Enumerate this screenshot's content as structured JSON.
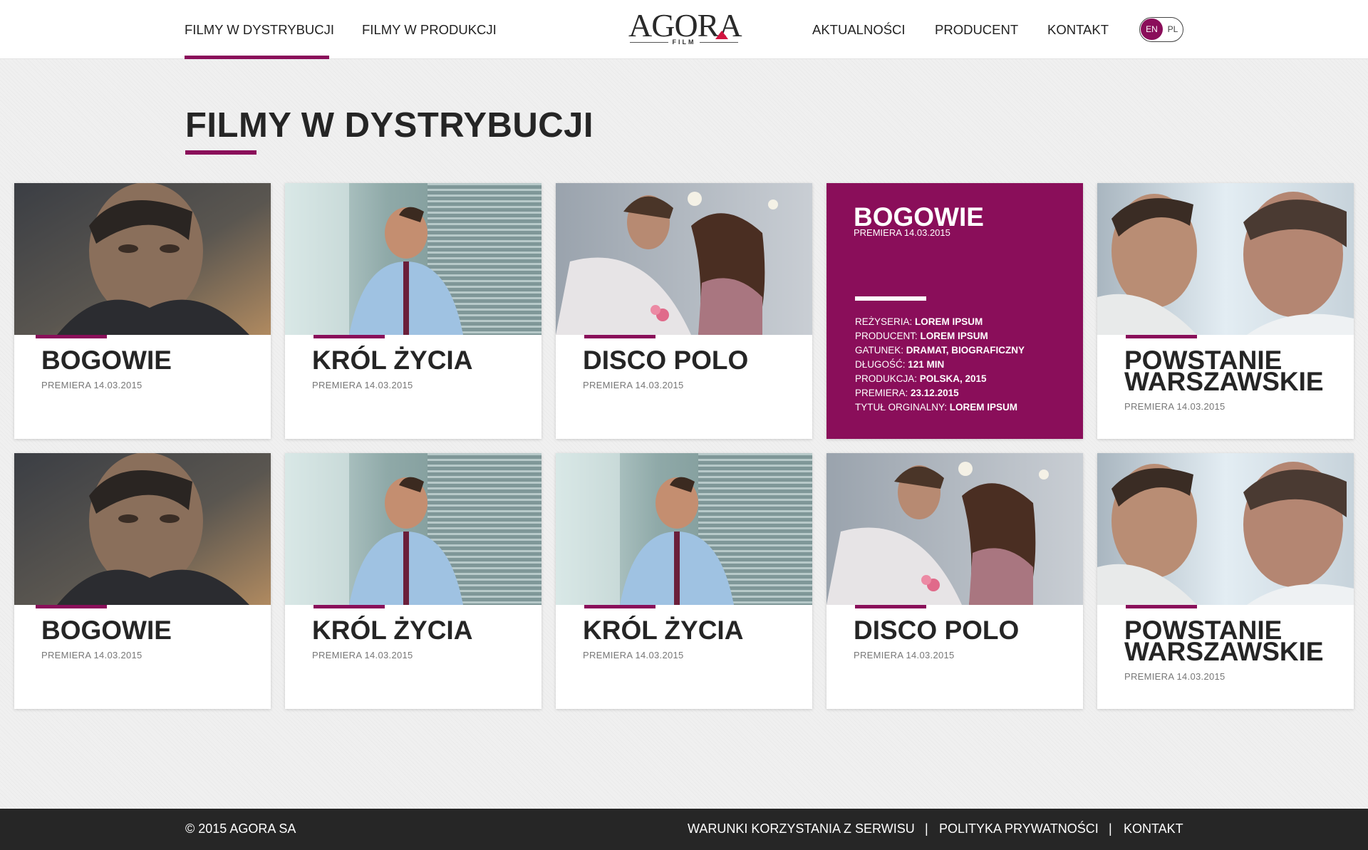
{
  "header": {
    "nav_left": [
      "FILMY W DYSTRYBUCJI",
      "FILMY W PRODUKCJI"
    ],
    "nav_right": [
      "AKTUALNOŚCI",
      "PRODUCENT",
      "KONTAKT"
    ],
    "logo_text": "AGORA",
    "logo_sub": "FILM",
    "lang_en": "EN",
    "lang_pl": "PL",
    "accent_color": "#8a0e5a"
  },
  "page": {
    "title": "FILMY W DYSTRYBUCJI"
  },
  "cards": [
    {
      "title": "BOGOWIE",
      "date": "PREMIERA 14.03.2015",
      "image": "portrait-man-dark-coat"
    },
    {
      "title": "KRÓL ŻYCIA",
      "date": "PREMIERA 14.03.2015",
      "image": "man-at-window-blinds"
    },
    {
      "title": "DISCO POLO",
      "date": "PREMIERA 14.03.2015",
      "image": "couple-with-flowers"
    },
    {
      "title": "BOGOWIE",
      "date": "PREMIERA 14.03.2015",
      "active": true
    },
    {
      "title": "POWSTANIE WARSZAWSKIE",
      "date": "PREMIERA 14.03.2015",
      "image": "two-men-facing"
    },
    {
      "title": "BOGOWIE",
      "date": "PREMIERA 14.03.2015",
      "image": "portrait-man-dark-coat"
    },
    {
      "title": "KRÓL ŻYCIA",
      "date": "PREMIERA 14.03.2015",
      "image": "man-at-window-blinds"
    },
    {
      "title": "KRÓL ŻYCIA",
      "date": "PREMIERA 14.03.2015",
      "image": "man-at-window-blinds"
    },
    {
      "title": "DISCO POLO",
      "date": "PREMIERA 14.03.2015",
      "image": "couple-with-flowers"
    },
    {
      "title": "POWSTANIE WARSZAWSKIE",
      "date": "PREMIERA 14.03.2015",
      "image": "two-men-facing"
    }
  ],
  "active_details": [
    {
      "label": "REŻYSERIA:",
      "value": "LOREM IPSUM"
    },
    {
      "label": "PRODUCENT:",
      "value": "LOREM IPSUM"
    },
    {
      "label": "GATUNEK:",
      "value": "DRAMAT, BIOGRAFICZNY"
    },
    {
      "label": "DŁUGOŚĆ:",
      "value": "121 MIN"
    },
    {
      "label": "PRODUKCJA:",
      "value": "POLSKA, 2015"
    },
    {
      "label": "PREMIERA:",
      "value": "23.12.2015"
    },
    {
      "label": "TYTUŁ ORGINALNY:",
      "value": "LOREM IPSUM"
    }
  ],
  "footer": {
    "copyright": "© 2015 AGORA SA",
    "links": [
      "WARUNKI KORZYSTANIA Z SERWISU",
      "POLITYKA PRYWATNOŚCI",
      "KONTAKT"
    ],
    "separator": "|"
  }
}
